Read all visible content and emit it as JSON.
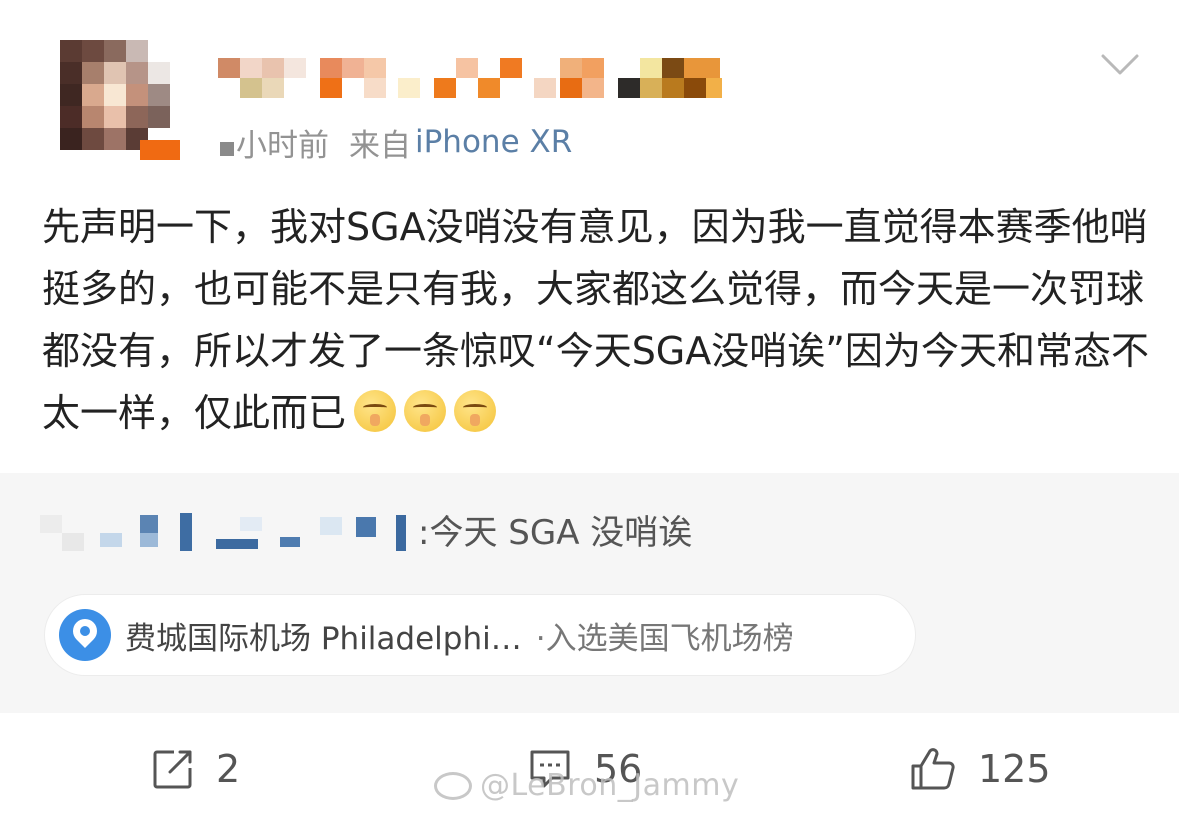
{
  "post": {
    "time_text": "小时前",
    "source_label": "来自",
    "device": "iPhone XR",
    "body": "先声明一下，我对SGA没哨没有意见，因为我一直觉得本赛季他哨挺多的，也可能不是只有我，大家都这么觉得，而今天是一次罚球都没有，所以才发了一条惊叹“今天SGA没哨诶”因为今天和常态不太一样，仅此而已",
    "emoji_icon": "shush-face-icon"
  },
  "repost": {
    "text": ":今天 SGA 没哨诶"
  },
  "location": {
    "icon": "location-pin-icon",
    "name": "费城国际机场 Philadelphi…",
    "tag": "·入选美国飞机场榜"
  },
  "actions": {
    "share_count": "2",
    "comment_count": "56",
    "like_count": "125"
  },
  "watermark": {
    "text": "@LeBron_Jammy"
  },
  "colors": {
    "link_blue": "#5b7fa6",
    "pin_blue": "#3c8fe6",
    "repost_bg": "#f6f6f6"
  }
}
